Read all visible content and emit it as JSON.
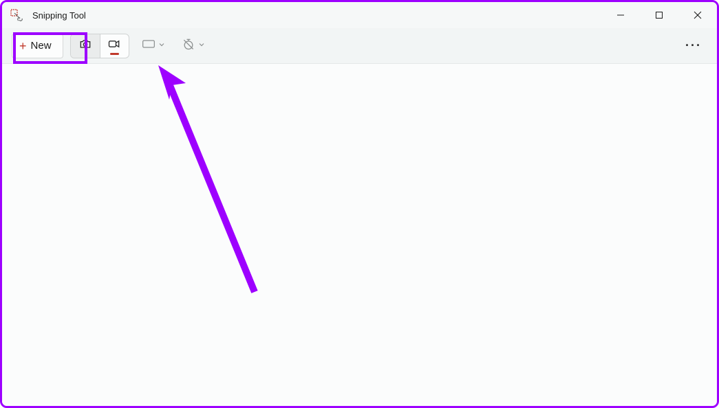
{
  "titlebar": {
    "app_title": "Snipping Tool"
  },
  "toolbar": {
    "new_label": "New"
  },
  "annotation": {
    "highlight_color": "#9d00ff"
  }
}
